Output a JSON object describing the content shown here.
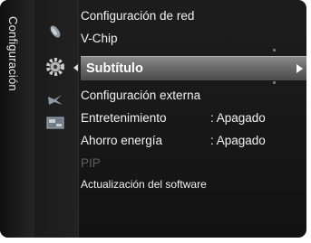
{
  "sidebar": {
    "title": "Configuración"
  },
  "icons": [
    "picture-icon",
    "setup-gear-icon",
    "input-icon",
    "application-icon"
  ],
  "menu": {
    "items": [
      {
        "label": "Configuración de red",
        "value": "",
        "enabled": true
      },
      {
        "label": "V-Chip",
        "value": "",
        "enabled": true
      },
      {
        "label": "Subtítulo",
        "value": "",
        "enabled": true,
        "selected": true
      },
      {
        "label": "Configuración externa",
        "value": "",
        "enabled": true
      },
      {
        "label": "Entretenimiento",
        "value": ": Apagado",
        "enabled": true
      },
      {
        "label": "Ahorro energía",
        "value": ": Apagado",
        "enabled": true
      },
      {
        "label": "PIP",
        "value": "",
        "enabled": false
      },
      {
        "label": "Actualización del software",
        "value": "",
        "enabled": true
      }
    ]
  },
  "colors": {
    "highlight": "#6a6a6a",
    "background": "#181818",
    "text": "#f2f2f2",
    "disabled_text": "#5e5e5e"
  }
}
